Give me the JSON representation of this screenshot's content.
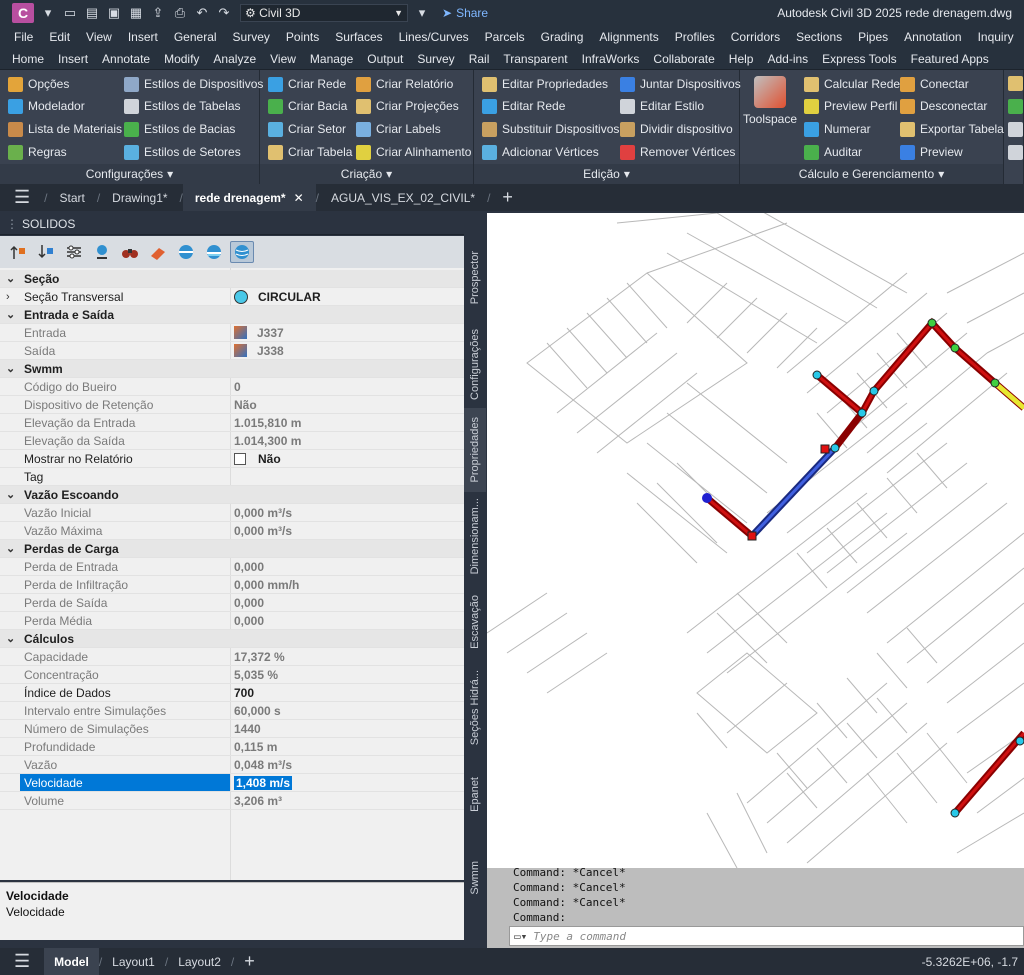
{
  "titlebar": {
    "app_letter": "C",
    "workspace": "Civil 3D",
    "share_label": "Share",
    "title": "Autodesk Civil 3D 2025    rede drenagem.dwg"
  },
  "menubar": [
    "File",
    "Edit",
    "View",
    "Insert",
    "General",
    "Survey",
    "Points",
    "Surfaces",
    "Lines/Curves",
    "Parcels",
    "Grading",
    "Alignments",
    "Profiles",
    "Corridors",
    "Sections",
    "Pipes",
    "Annotation",
    "Inquiry"
  ],
  "ribbon_tabs": [
    "Home",
    "Insert",
    "Annotate",
    "Modify",
    "Analyze",
    "View",
    "Manage",
    "Output",
    "Survey",
    "Rail",
    "Transparent",
    "InfraWorks",
    "Collaborate",
    "Help",
    "Add-ins",
    "Express Tools",
    "Featured Apps"
  ],
  "ribbon": {
    "configuracoes": {
      "title": "Configurações",
      "col1": [
        "Opções",
        "Modelador",
        "Lista de Materiais",
        "Regras"
      ],
      "col2": [
        "Estilos de Dispositivos",
        "Estilos de Tabelas",
        "Estilos de Bacias",
        "Estilos de Setores"
      ]
    },
    "criacao": {
      "title": "Criação",
      "col1": [
        "Criar Rede",
        "Criar Bacia",
        "Criar Setor",
        "Criar Tabela"
      ],
      "col2": [
        "Criar Relatório",
        "Criar Projeções",
        "Criar Labels",
        "Criar Alinhamento"
      ]
    },
    "edicao": {
      "title": "Edição",
      "col1": [
        "Editar Propriedades",
        "Editar Rede",
        "Substituir Dispositivos",
        "Adicionar Vértices"
      ],
      "col2": [
        "Juntar Dispositivos",
        "Editar Estilo",
        "Dividir dispositivo",
        "Remover Vértices"
      ]
    },
    "calculo": {
      "title": "Cálculo e Gerenciamento",
      "big": "Toolspace",
      "col1": [
        "Calcular Rede",
        "Preview Perfil",
        "Numerar",
        "Auditar"
      ],
      "col2": [
        "Conectar",
        "Desconectar",
        "Exportar Tabela",
        "Preview"
      ]
    }
  },
  "doc_tabs": [
    "Start",
    "Drawing1*",
    "rede drenagem*",
    "AGUA_VIS_EX_02_CIVIL*"
  ],
  "palette": {
    "title": "SOLIDOS",
    "rows": [
      {
        "type": "cat",
        "label": "Seção"
      },
      {
        "type": "prop",
        "label": "Seção Transversal",
        "value": "CIRCULAR",
        "dark": true,
        "expand": true,
        "icon": "circle"
      },
      {
        "type": "cat",
        "label": "Entrada e Saída"
      },
      {
        "type": "prop",
        "label": "Entrada",
        "value": "J337",
        "icon": "cube"
      },
      {
        "type": "prop",
        "label": "Saída",
        "value": "J338",
        "icon": "cube"
      },
      {
        "type": "cat",
        "label": "Swmm"
      },
      {
        "type": "prop",
        "label": "Código do Bueiro",
        "value": "0"
      },
      {
        "type": "prop",
        "label": "Dispositivo de Retenção",
        "value": "Não"
      },
      {
        "type": "prop",
        "label": "Elevação da Entrada",
        "value": "1.015,810 m"
      },
      {
        "type": "prop",
        "label": "Elevação da Saída",
        "value": "1.014,300 m"
      },
      {
        "type": "prop",
        "label": "Mostrar no Relatório",
        "value": "Não",
        "dark": true,
        "icon": "check"
      },
      {
        "type": "prop",
        "label": "Tag",
        "value": "",
        "dark": true
      },
      {
        "type": "cat",
        "label": "Vazão Escoando"
      },
      {
        "type": "prop",
        "label": "Vazão Inicial",
        "value": "0,000 m³/s"
      },
      {
        "type": "prop",
        "label": "Vazão Máxima",
        "value": "0,000 m³/s"
      },
      {
        "type": "cat",
        "label": "Perdas de Carga"
      },
      {
        "type": "prop",
        "label": "Perda de Entrada",
        "value": "0,000"
      },
      {
        "type": "prop",
        "label": "Perda de Infiltração",
        "value": "0,000 mm/h"
      },
      {
        "type": "prop",
        "label": "Perda de Saída",
        "value": "0,000"
      },
      {
        "type": "prop",
        "label": "Perda Média",
        "value": "0,000"
      },
      {
        "type": "cat",
        "label": "Cálculos"
      },
      {
        "type": "prop",
        "label": "Capacidade",
        "value": "17,372 %"
      },
      {
        "type": "prop",
        "label": "Concentração",
        "value": "5,035 %"
      },
      {
        "type": "prop",
        "label": "Índice de Dados",
        "value": "700",
        "dark": true
      },
      {
        "type": "prop",
        "label": "Intervalo entre Simulações",
        "value": "60,000 s"
      },
      {
        "type": "prop",
        "label": "Número de Simulações",
        "value": "1440"
      },
      {
        "type": "prop",
        "label": "Profundidade",
        "value": "0,115 m"
      },
      {
        "type": "prop",
        "label": "Vazão",
        "value": "0,048 m³/s"
      },
      {
        "type": "prop",
        "label": "Velocidade",
        "value": "1,408 m/s",
        "selected": true
      },
      {
        "type": "prop",
        "label": "Volume",
        "value": "3,206 m³"
      }
    ],
    "desc_title": "Velocidade",
    "desc_text": "Velocidade"
  },
  "side_tabs": [
    "Prospector",
    "Configurações",
    "Propriedades",
    "Dimensionam...",
    "Escavação",
    "Seções Hidrá...",
    "Epanet",
    "Swmm"
  ],
  "command": {
    "lines": [
      "Command: *Cancel*",
      "Command: *Cancel*",
      "Command: *Cancel*",
      "Command:"
    ],
    "placeholder": "Type a command"
  },
  "status": {
    "tabs": [
      "Model",
      "Layout1",
      "Layout2"
    ],
    "coords": "-5.3262E+06, -1.7"
  },
  "colors": {
    "pipe_red": "#c00000",
    "pipe_blue": "#3050d0",
    "node_cyan": "#28c8e8",
    "node_green": "#40d040",
    "pipe_yellow": "#e8e830"
  }
}
